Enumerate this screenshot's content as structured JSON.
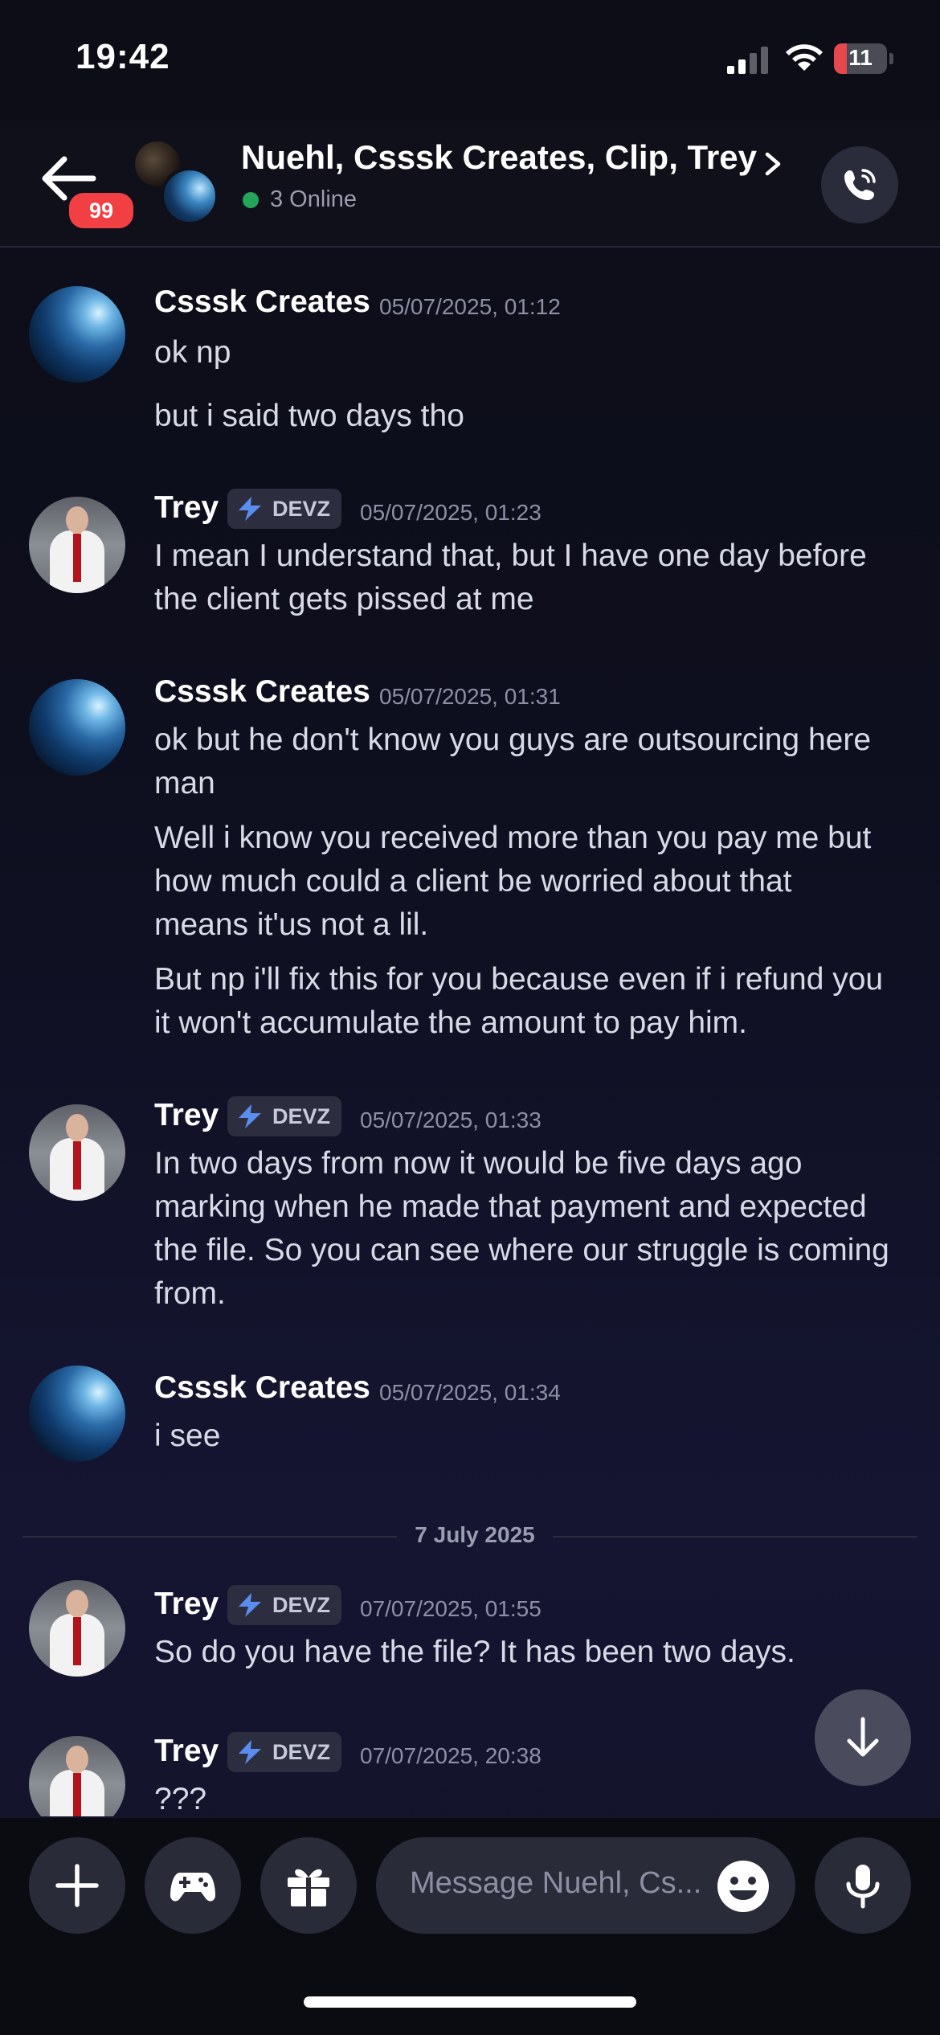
{
  "status_bar": {
    "time": "19:42",
    "battery": "11",
    "battery_fraction": 0.11
  },
  "header": {
    "unread_count": "99",
    "title": "Nuehl, Csssk Creates, Clip, Trey",
    "online_status": "3 Online"
  },
  "messages": [
    {
      "author": "Csssk Creates",
      "timestamp": "05/07/2025, 01:12",
      "lines": [
        "ok np",
        "but i said two days tho"
      ]
    },
    {
      "author": "Trey",
      "tag": "DEVZ",
      "timestamp": "05/07/2025, 01:23",
      "lines": [
        "I mean I understand that, but I have one day before",
        "the client gets pissed at me"
      ]
    },
    {
      "author": "Csssk Creates",
      "timestamp": "05/07/2025, 01:31",
      "lines": [
        "ok but he don't know you guys are outsourcing here",
        "man",
        "Well i know you received more than you pay me but",
        "how much could a client be worried about that",
        "means it'us not a lil.",
        "But np i'll fix this for you because even if i refund you",
        "it won't accumulate the amount to pay him."
      ]
    },
    {
      "author": "Trey",
      "tag": "DEVZ",
      "timestamp": "05/07/2025, 01:33",
      "lines": [
        "In two days from now it would be five days ago",
        "marking when he made that payment and expected",
        "the file. So you can see where our struggle is coming",
        "from."
      ]
    },
    {
      "author": "Csssk Creates",
      "timestamp": "05/07/2025, 01:34",
      "lines": [
        "i see"
      ]
    },
    {
      "author": "Trey",
      "tag": "DEVZ",
      "timestamp": "07/07/2025, 01:55",
      "lines": [
        "So do you have the file? It has been two days."
      ]
    },
    {
      "author": "Trey",
      "tag": "DEVZ",
      "timestamp": "07/07/2025, 20:38",
      "lines": [
        "???"
      ]
    }
  ],
  "date_divider": "7 July 2025",
  "composer": {
    "placeholder": "Message Nuehl, Cs..."
  }
}
